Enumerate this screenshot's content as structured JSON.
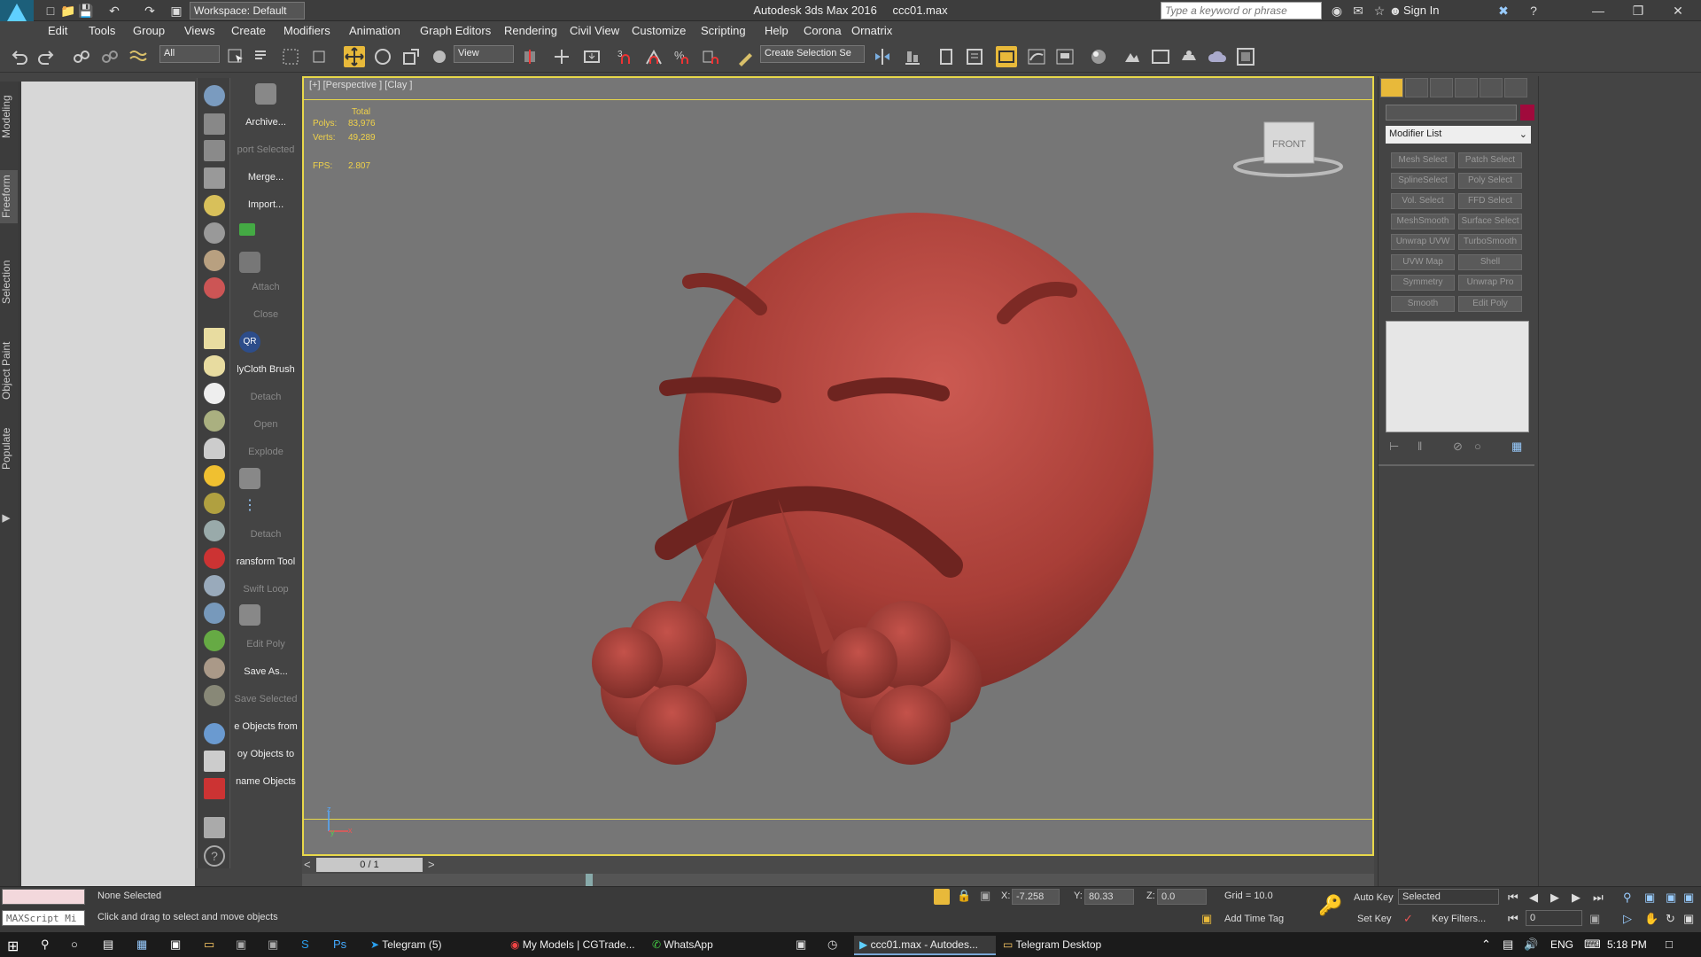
{
  "title_bar": {
    "app_logo_label": "MAX",
    "workspace": "Workspace: Default",
    "window_title": "Autodesk 3ds Max 2016",
    "file_name": "ccc01.max",
    "search_placeholder": "Type a keyword or phrase",
    "sign_in": "Sign In"
  },
  "menu": [
    "Edit",
    "Tools",
    "Group",
    "Views",
    "Create",
    "Modifiers",
    "Animation",
    "Graph Editors",
    "Rendering",
    "Civil View",
    "Customize",
    "Scripting",
    "Help",
    "Corona",
    "Ornatrix"
  ],
  "toolbar": {
    "filter_select": "All",
    "ref_coord_select": "View",
    "selection_set_placeholder": "Create Selection Se"
  },
  "left_tabs": [
    "Modeling",
    "Freeform",
    "Selection",
    "Object Paint",
    "Populate"
  ],
  "script_panel": [
    {
      "label": "Archive...",
      "dim": false
    },
    {
      "label": "port Selected",
      "dim": true
    },
    {
      "label": "Merge...",
      "dim": false
    },
    {
      "label": "Import...",
      "dim": false
    },
    {
      "label": "Attach",
      "dim": true
    },
    {
      "label": "Close",
      "dim": true
    },
    {
      "label": "lyCloth Brush",
      "dim": false
    },
    {
      "label": "Detach",
      "dim": true
    },
    {
      "label": "Open",
      "dim": true
    },
    {
      "label": "Explode",
      "dim": true
    },
    {
      "label": "Detach",
      "dim": true
    },
    {
      "label": "ransform Tool",
      "dim": false
    },
    {
      "label": "Swift Loop",
      "dim": true
    },
    {
      "label": "Edit Poly",
      "dim": true
    },
    {
      "label": "Save As...",
      "dim": false
    },
    {
      "label": "Save Selected",
      "dim": true
    },
    {
      "label": "e Objects from",
      "dim": false
    },
    {
      "label": "oy Objects to",
      "dim": false
    },
    {
      "label": "name Objects",
      "dim": false
    }
  ],
  "qr_label": "QR",
  "viewport": {
    "label": "[+] [Perspective ] [Clay ]",
    "stats_total": "Total",
    "polys_label": "Polys:",
    "polys_value": "83,976",
    "verts_label": "Verts:",
    "verts_value": "49,289",
    "fps_label": "FPS:",
    "fps_value": "2.807",
    "viewcube_face": "FRONT",
    "axis_z": "z",
    "axis_x": "x",
    "axis_y": "y",
    "model_color": "#b5463f"
  },
  "time_slider": {
    "frame": "0 / 1",
    "prev": "<",
    "next": ">"
  },
  "command_panel": {
    "modifier_list": "Modifier List",
    "color_swatch": "#a00a3c",
    "modifier_buttons": [
      "Mesh Select",
      "Patch Select",
      "SplineSelect",
      "Poly Select",
      "Vol. Select",
      "FFD Select",
      "MeshSmooth",
      "Surface Select",
      "Unwrap UVW",
      "TurboSmooth",
      "UVW Map",
      "Shell",
      "Symmetry",
      "Unwrap Pro",
      "Smooth",
      "Edit Poly"
    ]
  },
  "status": {
    "maxscript": "MAXScript Mi",
    "selection": "None Selected",
    "prompt": "Click and drag to select and move objects",
    "x_label": "X:",
    "x_value": "-7.258",
    "y_label": "Y:",
    "y_value": "80.33",
    "z_label": "Z:",
    "z_value": "0.0",
    "grid": "Grid = 10.0",
    "add_time_tag": "Add Time Tag",
    "auto_key": "Auto Key",
    "set_key": "Set Key",
    "key_mode": "Selected",
    "key_filters": "Key Filters...",
    "frame_field": "0"
  },
  "taskbar": {
    "items": [
      "Telegram (5)",
      "My Models | CGTrade...",
      "WhatsApp",
      "ccc01.max - Autodes...",
      "Telegram Desktop"
    ],
    "language": "ENG",
    "time": "5:18 PM"
  }
}
